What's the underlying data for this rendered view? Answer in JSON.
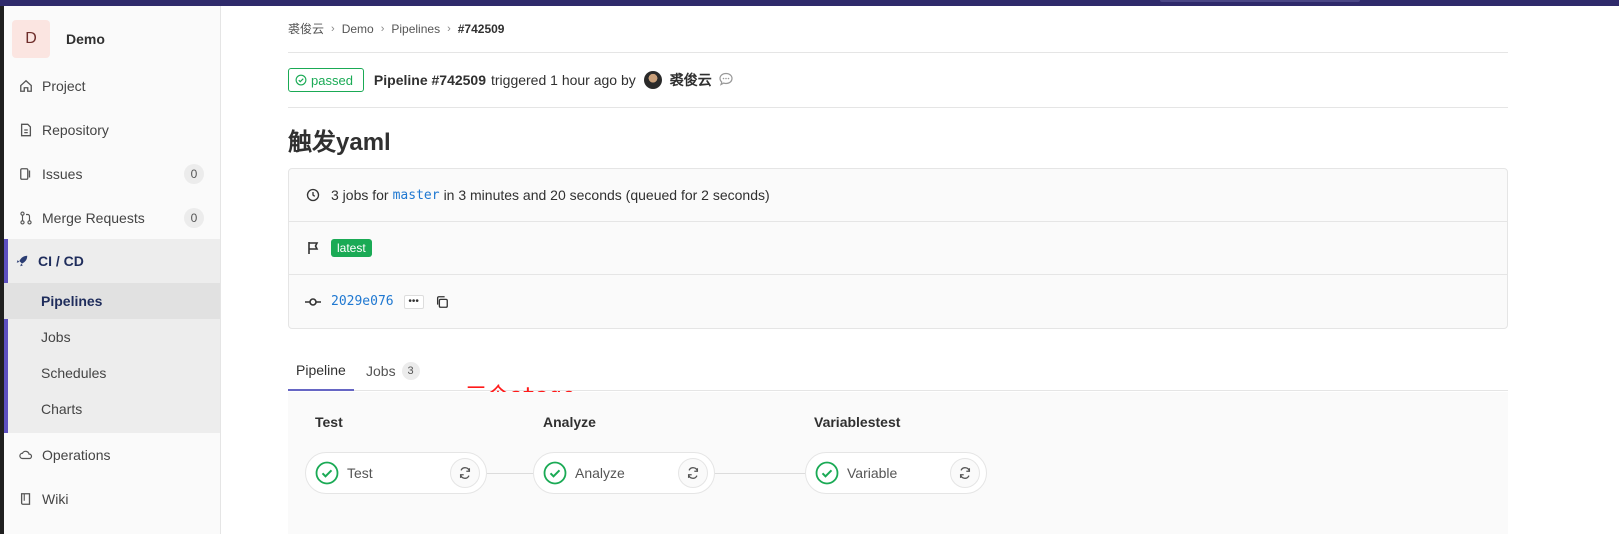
{
  "project": {
    "initial": "D",
    "name": "Demo"
  },
  "sidebar": {
    "items": [
      {
        "label": "Project",
        "icon": "home-icon"
      },
      {
        "label": "Repository",
        "icon": "document-icon"
      },
      {
        "label": "Issues",
        "icon": "issues-icon",
        "count": "0"
      },
      {
        "label": "Merge Requests",
        "icon": "merge-request-icon",
        "count": "0"
      },
      {
        "label": "CI / CD",
        "icon": "rocket-icon"
      },
      {
        "label": "Operations",
        "icon": "cloud-gear-icon"
      },
      {
        "label": "Wiki",
        "icon": "book-icon"
      }
    ],
    "cicd_sub": [
      "Pipelines",
      "Jobs",
      "Schedules",
      "Charts"
    ]
  },
  "breadcrumb": [
    "裘俊云",
    "Demo",
    "Pipelines",
    "#742509"
  ],
  "pipeline": {
    "status": "passed",
    "title_prefix": "Pipeline #742509",
    "triggered_text": "triggered 1 hour ago by",
    "user": "裘俊云",
    "commit_title": "触发yaml",
    "jobs_summary_prefix": "3 jobs for",
    "branch": "master",
    "jobs_summary_suffix": "in 3 minutes and 20 seconds (queued for 2 seconds)",
    "tag": "latest",
    "sha": "2029e076",
    "ellipsis": "•••"
  },
  "tabs": [
    {
      "label": "Pipeline"
    },
    {
      "label": "Jobs",
      "count": "3"
    }
  ],
  "annotation": "三个stage",
  "stages": [
    {
      "title": "Test",
      "job": "Test"
    },
    {
      "title": "Analyze",
      "job": "Analyze"
    },
    {
      "title": "Variablestest",
      "job": "Variable"
    }
  ],
  "colors": {
    "success": "#1aaa55",
    "nav_accent": "#5c4fbf",
    "link": "#1f78d1",
    "annotation": "#ff1a1a"
  }
}
